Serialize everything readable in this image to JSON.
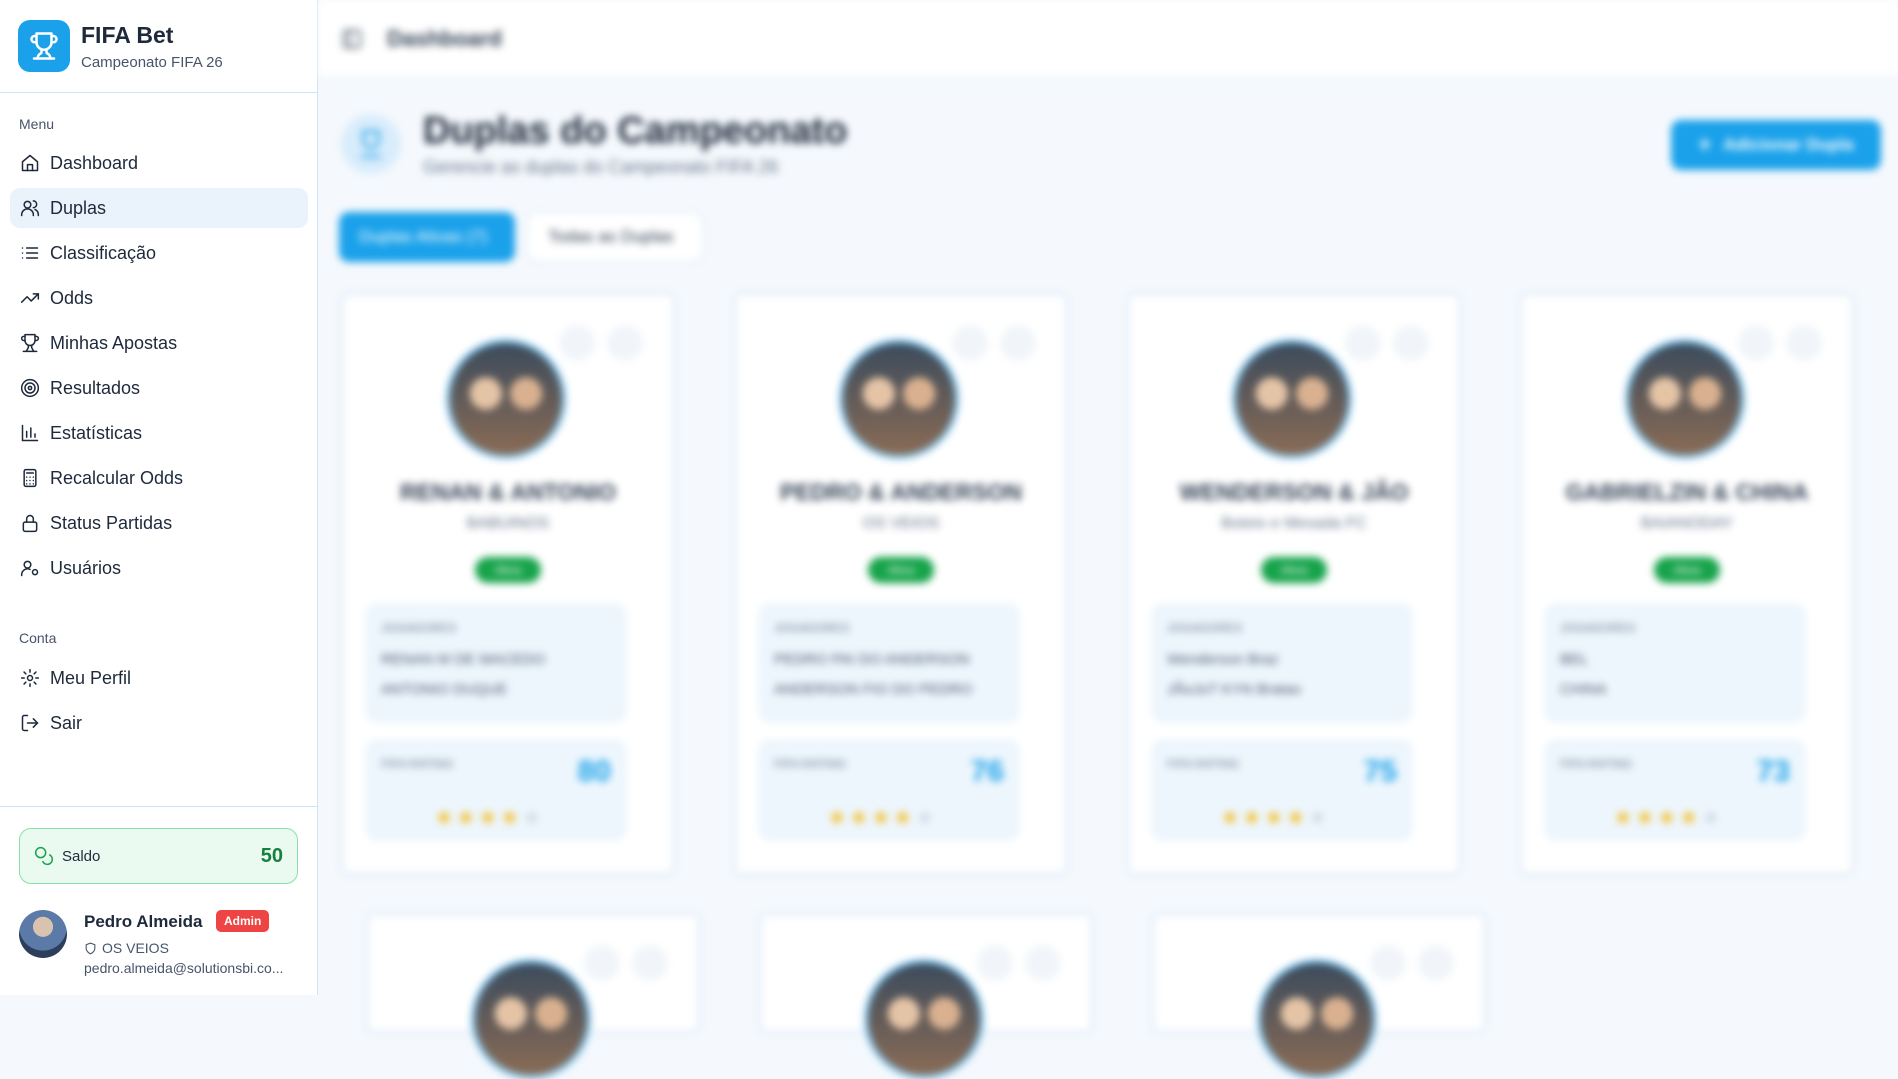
{
  "app": {
    "title": "FIFA Bet",
    "subtitle": "Campeonato FIFA 26"
  },
  "sidebar": {
    "menu_label": "Menu",
    "items": [
      {
        "label": "Dashboard",
        "icon": "home-icon"
      },
      {
        "label": "Duplas",
        "icon": "users-icon",
        "active": true
      },
      {
        "label": "Classificação",
        "icon": "list-icon"
      },
      {
        "label": "Odds",
        "icon": "trending-up-icon"
      },
      {
        "label": "Minhas Apostas",
        "icon": "trophy-icon"
      },
      {
        "label": "Resultados",
        "icon": "target-icon"
      },
      {
        "label": "Estatísticas",
        "icon": "bar-chart-icon"
      },
      {
        "label": "Recalcular Odds",
        "icon": "calculator-icon"
      },
      {
        "label": "Status Partidas",
        "icon": "lock-icon"
      },
      {
        "label": "Usuários",
        "icon": "user-cog-icon"
      }
    ],
    "account_label": "Conta",
    "account_items": [
      {
        "label": "Meu Perfil",
        "icon": "gear-icon"
      },
      {
        "label": "Sair",
        "icon": "logout-icon"
      }
    ],
    "saldo": {
      "label": "Saldo",
      "value": "50"
    },
    "user": {
      "name": "Pedro Almeida",
      "badge": "Admin",
      "team": "OS VEIOS",
      "email": "pedro.almeida@solutionsbi.co..."
    }
  },
  "topbar": {
    "title": "Dashboard"
  },
  "page": {
    "title": "Duplas do Campeonato",
    "subtitle": "Gerencie as duplas do Campeonato FIFA 26",
    "add_button": "Adicionar Dupla",
    "tabs": [
      "Duplas Ativas (7)",
      "Todas as Duplas"
    ]
  },
  "cards": [
    {
      "name": "RENAN & ANTONIO",
      "team": "BABUINOS",
      "status": "Ativa",
      "members_label": "JOGADORES",
      "member1": "RENAN M DE MACEDO",
      "member2": "ANTONIO DUQUE",
      "rating_label": "FIFA RATING",
      "rating": "80",
      "stars": 4
    },
    {
      "name": "PEDRO & ANDERSON",
      "team": "OS VEIOS",
      "status": "Ativa",
      "members_label": "JOGADORES",
      "member1": "PEDRO PAI DO ANDERSON",
      "member2": "ANDERSON FIO DO PEDRO",
      "rating_label": "FIFA RATING",
      "rating": "76",
      "stars": 4
    },
    {
      "name": "WENDERSON & JÃO",
      "team": "Boteio e Mesada FC",
      "status": "Ativa",
      "members_label": "JOGADORES",
      "member1": "Wenderson Braz",
      "member2": "JÃoJoT KYN Bratao",
      "rating_label": "FIFA RATING",
      "rating": "75",
      "stars": 4
    },
    {
      "name": "GABRIELZIN & CHINA",
      "team": "BAIANODAY",
      "status": "Ativa",
      "members_label": "JOGADORES",
      "member1": "BEL",
      "member2": "CHINA",
      "rating_label": "FIFA RATING",
      "rating": "73",
      "stars": 4
    }
  ]
}
